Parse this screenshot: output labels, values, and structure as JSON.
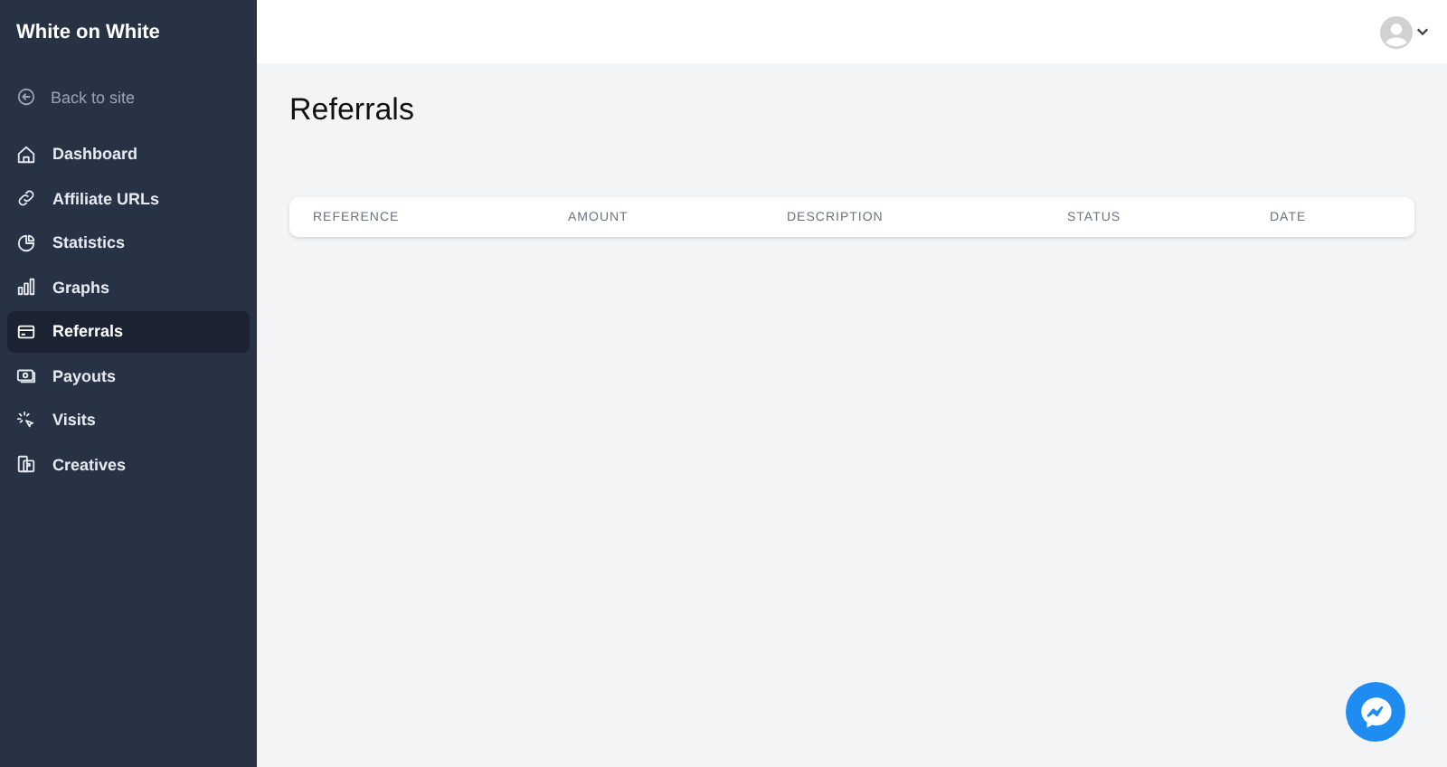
{
  "sidebar": {
    "title": "White on White",
    "back_link": "Back to site",
    "items": [
      {
        "label": "Dashboard",
        "selected": false
      },
      {
        "label": "Affiliate URLs",
        "selected": false
      },
      {
        "label": "Statistics",
        "selected": false
      },
      {
        "label": "Graphs",
        "selected": false
      },
      {
        "label": "Referrals",
        "selected": true
      },
      {
        "label": "Payouts",
        "selected": false
      },
      {
        "label": "Visits",
        "selected": false
      },
      {
        "label": "Creatives",
        "selected": false
      }
    ]
  },
  "page": {
    "title": "Referrals"
  },
  "table": {
    "columns": [
      "REFERENCE",
      "AMOUNT",
      "DESCRIPTION",
      "STATUS",
      "DATE"
    ]
  }
}
